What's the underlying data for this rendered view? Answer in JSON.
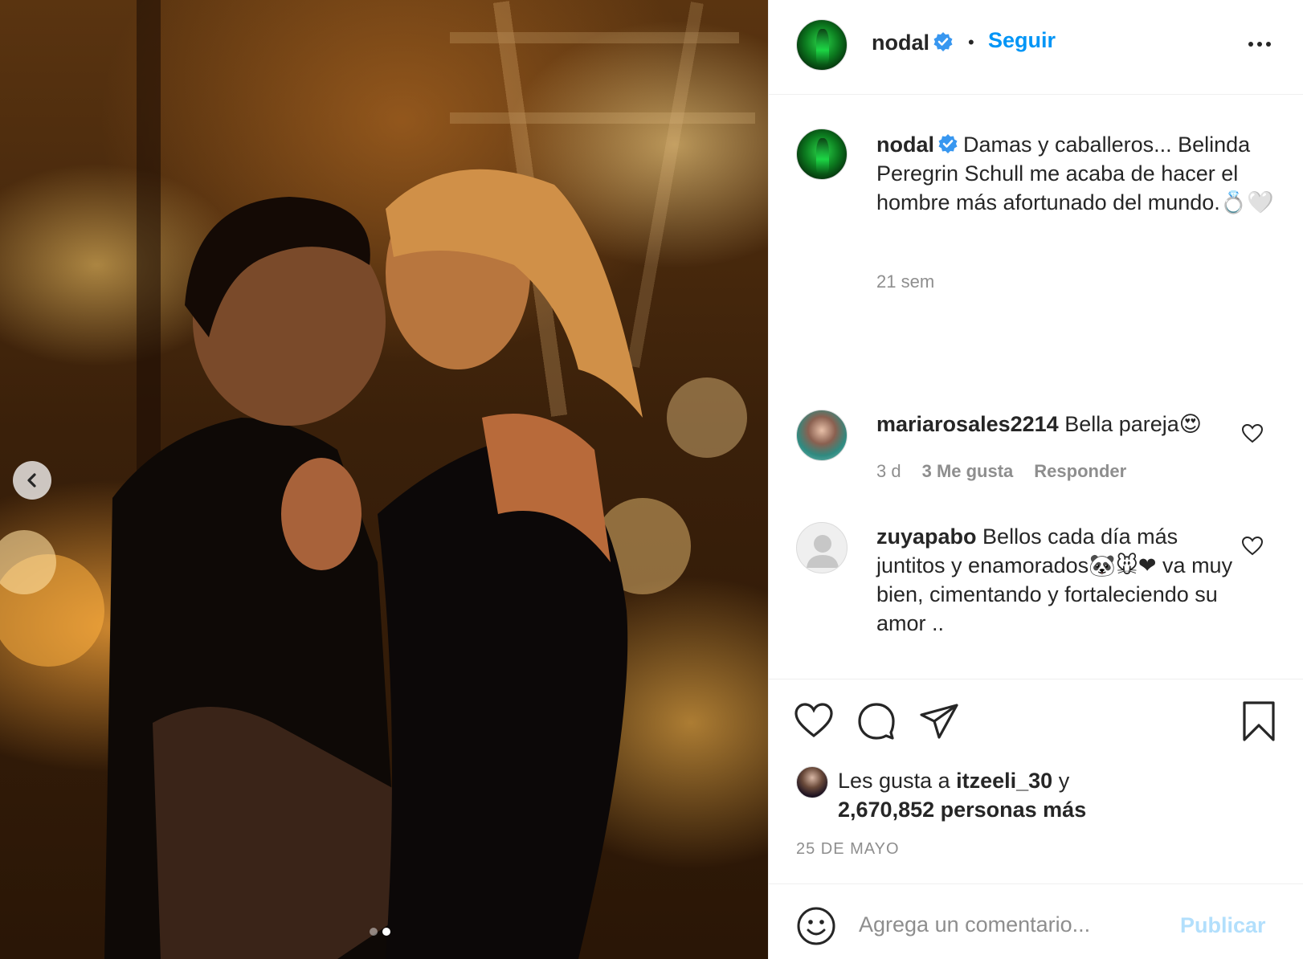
{
  "post": {
    "photo_alt": "",
    "carousel": {
      "current": 2,
      "total": 2
    }
  },
  "header": {
    "username": "nodal",
    "separator": "•",
    "follow_label": "Seguir"
  },
  "caption": {
    "username": "nodal",
    "text": "Damas y caballeros... Belinda Peregrin Schull me acaba de hacer el hombre más afortunado del mundo.💍🤍",
    "time": "21 sem"
  },
  "comments": [
    {
      "username": "mariarosales2214",
      "text": "Bella pareja😍",
      "time": "3 d",
      "likes": "3 Me gusta",
      "reply_label": "Responder"
    },
    {
      "username": "zuyapabo",
      "text": "Bellos cada día más juntitos y enamorados🐼🐭❤ va muy bien, cimentando y fortaleciendo su amor .."
    }
  ],
  "likes": {
    "prefix": "Les gusta a",
    "user": "itzeeli_30",
    "conj": "y",
    "count_text": "2,670,852 personas más"
  },
  "date": "25 DE MAYO",
  "add_comment": {
    "placeholder": "Agrega un comentario...",
    "post_label": "Publicar"
  },
  "colors": {
    "accent": "#0095f6",
    "post_disabled": "#b2dffc",
    "muted": "#8e8e8e",
    "text": "#262626",
    "border": "#efefef"
  },
  "icons": [
    "chevron-left-icon",
    "verified-badge-icon",
    "more-options-icon",
    "heart-icon",
    "comment-icon",
    "share-icon",
    "bookmark-icon",
    "emoji-icon"
  ]
}
